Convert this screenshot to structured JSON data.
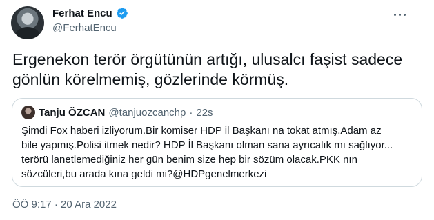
{
  "tweet": {
    "author_name": "Ferhat Encu",
    "author_handle": "@FerhatEncu",
    "verified_icon": "verified-badge-icon",
    "more_icon": "more-options-icon",
    "text": "Ergenekon terör örgütünün artığı, ulusalcı faşist sadece gönlün körelmemiş, gözlerinde körmüş.",
    "time": "ÖÖ 9:17",
    "separator": "·",
    "date": "20 Ara 2022"
  },
  "quoted": {
    "author_name": "Tanju ÖZCAN",
    "author_handle": "@tanjuozcanchp",
    "separator": "·",
    "time": "22s",
    "text_lines": [
      "Şimdi Fox haberi izliyorum.Bir komiser HDP il Başkanı na tokat atmış.Adam az",
      "bile yapmış.Polisi itmek nedir? HDP İl Başkanı olman sana ayrıcalık mı sağlıyor...",
      "terörü lanetlemediğiniz her gün benim size hep bir sözüm olacak.PKK nın",
      "sözcüleri,bu arada kına geldi mi?@HDPgenelmerkezi"
    ]
  },
  "colors": {
    "verified": "#1d9bf0",
    "text": "#0f1419",
    "secondary": "#536471",
    "border": "#cfd9de"
  }
}
